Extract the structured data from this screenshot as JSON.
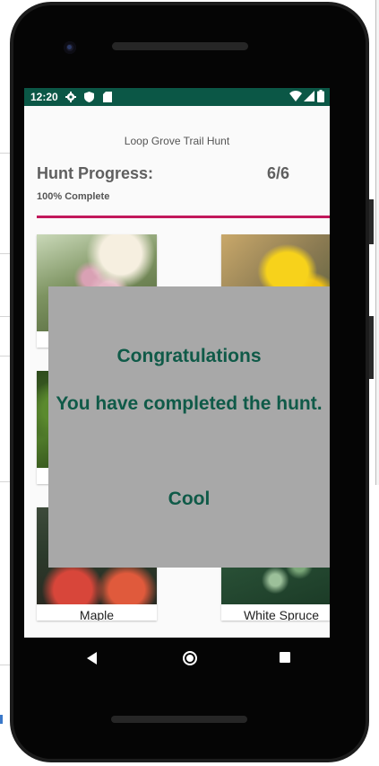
{
  "status_bar": {
    "time": "12:20",
    "left_icons": [
      "gear-icon",
      "shield-icon",
      "sd-card-icon"
    ],
    "right_icons": [
      "wifi-icon",
      "signal-icon",
      "battery-icon"
    ]
  },
  "app": {
    "title": "Loop Grove Trail Hunt",
    "progress_label": "Hunt Progress:",
    "progress_count": "6/6",
    "progress_percent_text": "100% Complete",
    "progress_value": 1.0,
    "accent_color": "#c2185b",
    "header_color": "#0b5746"
  },
  "grid": {
    "items": [
      {
        "label": "",
        "image": "stock-flower"
      },
      {
        "label": "",
        "image": "daffodil"
      },
      {
        "label": "",
        "image": "leaf"
      },
      {
        "label": "",
        "image": "leaf"
      },
      {
        "label": "Maple",
        "image": "maple-leaves"
      },
      {
        "label": "White Spruce",
        "image": "spruce-needles"
      }
    ]
  },
  "dialog": {
    "title": "Congratulations",
    "message": "You have completed the hunt.",
    "button": "Cool",
    "background": "#a8a8a8",
    "text_color": "#0f5a48"
  },
  "nav_bar": {
    "icons": [
      "back-icon",
      "home-icon",
      "recents-icon"
    ]
  }
}
